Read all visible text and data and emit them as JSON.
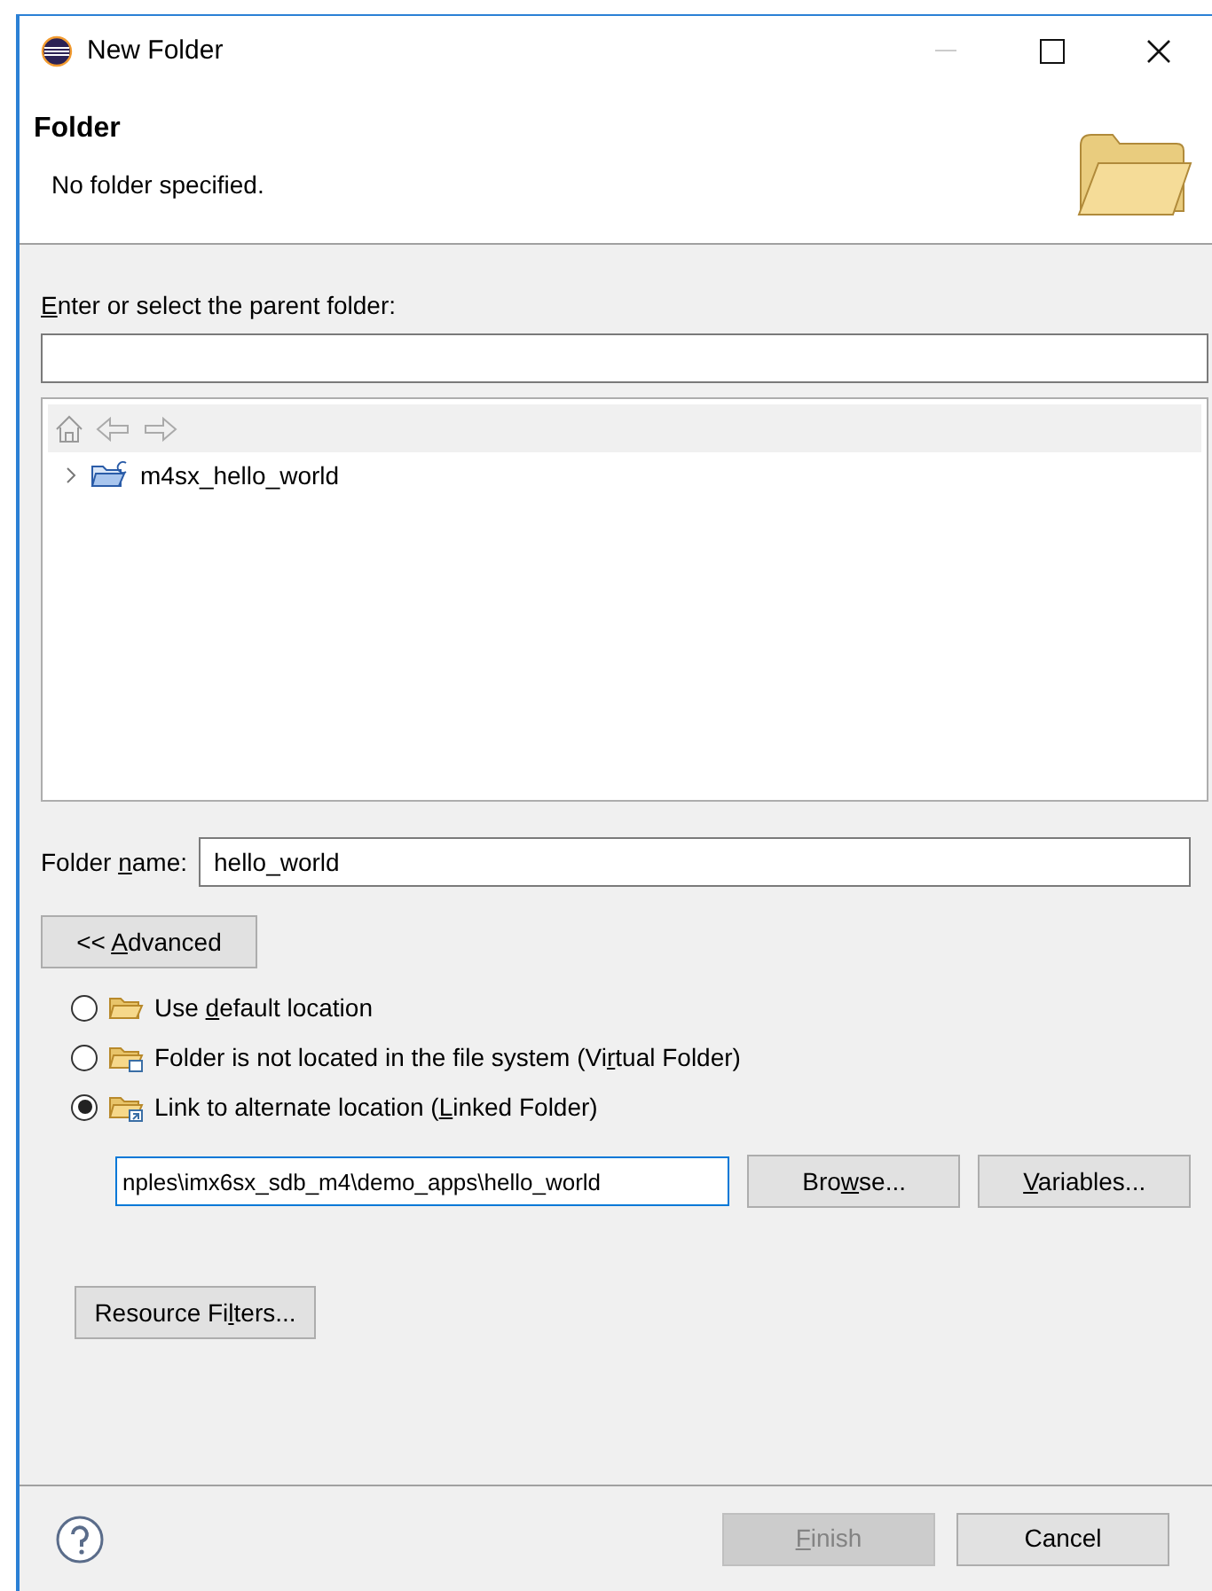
{
  "window": {
    "title": "New Folder"
  },
  "header": {
    "title": "Folder",
    "message": "No folder specified."
  },
  "parent": {
    "label": {
      "key": "E",
      "after": "nter or select the parent folder:"
    }
  },
  "tree": {
    "items": [
      {
        "label": "m4sx_hello_world",
        "expanded": false
      }
    ]
  },
  "folder_name": {
    "label": {
      "before": "Folder ",
      "key": "n",
      "after": "ame:"
    },
    "value": "hello_world"
  },
  "advanced_button": {
    "before": "<< ",
    "key": "A",
    "after": "dvanced"
  },
  "location_options": [
    {
      "kind": "default",
      "label": {
        "before": "Use ",
        "key": "d",
        "after": "efault location"
      },
      "selected": false
    },
    {
      "kind": "virtual",
      "label": {
        "before": "Folder is not located in the file system (Vi",
        "key": "r",
        "after": "tual Folder)"
      },
      "selected": false
    },
    {
      "kind": "linked",
      "label": {
        "before": "Link to alternate location (",
        "key": "L",
        "after": "inked Folder)"
      },
      "selected": true
    }
  ],
  "location": {
    "value": "nples\\imx6sx_sdb_m4\\demo_apps\\hello_world",
    "browse": {
      "before": "Bro",
      "key": "w",
      "after": "se..."
    },
    "variables": {
      "key": "V",
      "after": "ariables..."
    }
  },
  "resource_filters": {
    "before": "Resource Fi",
    "key": "l",
    "after": "ters..."
  },
  "buttons": [
    {
      "label": {
        "key": "F",
        "after": "inish"
      },
      "disabled": true
    },
    {
      "label": {
        "before": "Cancel"
      },
      "disabled": false
    }
  ]
}
